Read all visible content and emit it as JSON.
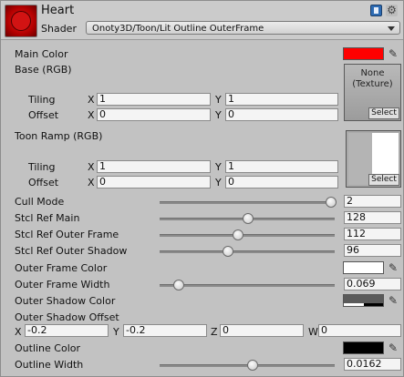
{
  "header": {
    "material_name": "Heart",
    "shader_label": "Shader",
    "shader_value": "Onoty3D/Toon/Lit Outline OuterFrame"
  },
  "colors": {
    "main_color": "#ff0000",
    "outer_frame_color": "#ffffff",
    "outline_color": "#000000"
  },
  "props": {
    "main_color": "Main Color",
    "base_rgb": "Base (RGB)",
    "tiling": "Tiling",
    "offset": "Offset",
    "toon_ramp": "Toon Ramp (RGB)",
    "cull_mode": "Cull Mode",
    "stcl_ref_main": "Stcl Ref Main",
    "stcl_ref_outer_frame": "Stcl Ref Outer Frame",
    "stcl_ref_outer_shadow": "Stcl Ref Outer Shadow",
    "outer_frame_color": "Outer Frame Color",
    "outer_frame_width": "Outer Frame Width",
    "outer_shadow_color": "Outer Shadow Color",
    "outer_shadow_offset": "Outer Shadow Offset",
    "outline_color": "Outline Color",
    "outline_width": "Outline Width"
  },
  "axes": {
    "x": "X",
    "y": "Y",
    "z": "Z",
    "w": "W"
  },
  "base_tex": {
    "none_line1": "None",
    "none_line2": "(Texture)",
    "select": "Select",
    "tiling_x": "1",
    "tiling_y": "1",
    "offset_x": "0",
    "offset_y": "0"
  },
  "ramp_tex": {
    "select": "Select",
    "tiling_x": "1",
    "tiling_y": "1",
    "offset_x": "0",
    "offset_y": "0"
  },
  "sliders": {
    "cull_mode": {
      "value": "2",
      "fraction": 1.0
    },
    "stcl_ref_main": {
      "value": "128",
      "fraction": 0.5
    },
    "stcl_ref_outer_frame": {
      "value": "112",
      "fraction": 0.44
    },
    "stcl_ref_outer_shadow": {
      "value": "96",
      "fraction": 0.38
    },
    "outer_frame_width": {
      "value": "0.069",
      "fraction": 0.08
    },
    "outline_width": {
      "value": "0.0162",
      "fraction": 0.53
    }
  },
  "shadow_offset": {
    "x": "-0.2",
    "y": "-0.2",
    "z": "0",
    "w": "0"
  }
}
